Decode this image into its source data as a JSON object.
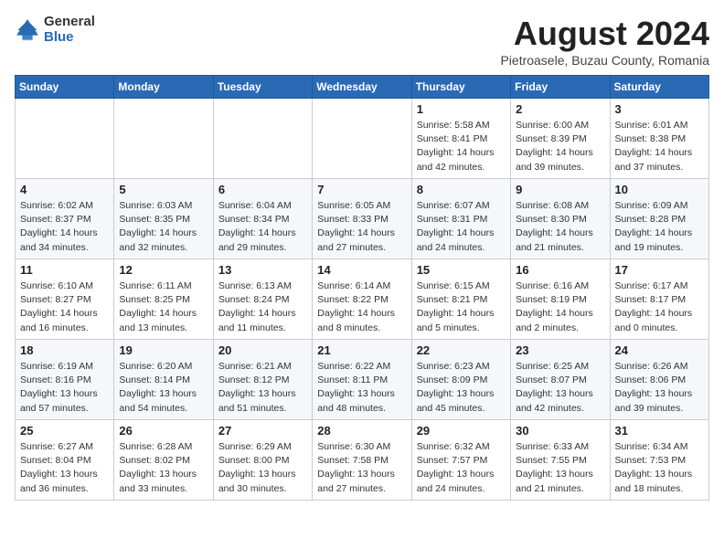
{
  "logo": {
    "general": "General",
    "blue": "Blue"
  },
  "header": {
    "title": "August 2024",
    "subtitle": "Pietroasele, Buzau County, Romania"
  },
  "weekdays": [
    "Sunday",
    "Monday",
    "Tuesday",
    "Wednesday",
    "Thursday",
    "Friday",
    "Saturday"
  ],
  "weeks": [
    [
      {
        "day": "",
        "info": ""
      },
      {
        "day": "",
        "info": ""
      },
      {
        "day": "",
        "info": ""
      },
      {
        "day": "",
        "info": ""
      },
      {
        "day": "1",
        "info": "Sunrise: 5:58 AM\nSunset: 8:41 PM\nDaylight: 14 hours and 42 minutes."
      },
      {
        "day": "2",
        "info": "Sunrise: 6:00 AM\nSunset: 8:39 PM\nDaylight: 14 hours and 39 minutes."
      },
      {
        "day": "3",
        "info": "Sunrise: 6:01 AM\nSunset: 8:38 PM\nDaylight: 14 hours and 37 minutes."
      }
    ],
    [
      {
        "day": "4",
        "info": "Sunrise: 6:02 AM\nSunset: 8:37 PM\nDaylight: 14 hours and 34 minutes."
      },
      {
        "day": "5",
        "info": "Sunrise: 6:03 AM\nSunset: 8:35 PM\nDaylight: 14 hours and 32 minutes."
      },
      {
        "day": "6",
        "info": "Sunrise: 6:04 AM\nSunset: 8:34 PM\nDaylight: 14 hours and 29 minutes."
      },
      {
        "day": "7",
        "info": "Sunrise: 6:05 AM\nSunset: 8:33 PM\nDaylight: 14 hours and 27 minutes."
      },
      {
        "day": "8",
        "info": "Sunrise: 6:07 AM\nSunset: 8:31 PM\nDaylight: 14 hours and 24 minutes."
      },
      {
        "day": "9",
        "info": "Sunrise: 6:08 AM\nSunset: 8:30 PM\nDaylight: 14 hours and 21 minutes."
      },
      {
        "day": "10",
        "info": "Sunrise: 6:09 AM\nSunset: 8:28 PM\nDaylight: 14 hours and 19 minutes."
      }
    ],
    [
      {
        "day": "11",
        "info": "Sunrise: 6:10 AM\nSunset: 8:27 PM\nDaylight: 14 hours and 16 minutes."
      },
      {
        "day": "12",
        "info": "Sunrise: 6:11 AM\nSunset: 8:25 PM\nDaylight: 14 hours and 13 minutes."
      },
      {
        "day": "13",
        "info": "Sunrise: 6:13 AM\nSunset: 8:24 PM\nDaylight: 14 hours and 11 minutes."
      },
      {
        "day": "14",
        "info": "Sunrise: 6:14 AM\nSunset: 8:22 PM\nDaylight: 14 hours and 8 minutes."
      },
      {
        "day": "15",
        "info": "Sunrise: 6:15 AM\nSunset: 8:21 PM\nDaylight: 14 hours and 5 minutes."
      },
      {
        "day": "16",
        "info": "Sunrise: 6:16 AM\nSunset: 8:19 PM\nDaylight: 14 hours and 2 minutes."
      },
      {
        "day": "17",
        "info": "Sunrise: 6:17 AM\nSunset: 8:17 PM\nDaylight: 14 hours and 0 minutes."
      }
    ],
    [
      {
        "day": "18",
        "info": "Sunrise: 6:19 AM\nSunset: 8:16 PM\nDaylight: 13 hours and 57 minutes."
      },
      {
        "day": "19",
        "info": "Sunrise: 6:20 AM\nSunset: 8:14 PM\nDaylight: 13 hours and 54 minutes."
      },
      {
        "day": "20",
        "info": "Sunrise: 6:21 AM\nSunset: 8:12 PM\nDaylight: 13 hours and 51 minutes."
      },
      {
        "day": "21",
        "info": "Sunrise: 6:22 AM\nSunset: 8:11 PM\nDaylight: 13 hours and 48 minutes."
      },
      {
        "day": "22",
        "info": "Sunrise: 6:23 AM\nSunset: 8:09 PM\nDaylight: 13 hours and 45 minutes."
      },
      {
        "day": "23",
        "info": "Sunrise: 6:25 AM\nSunset: 8:07 PM\nDaylight: 13 hours and 42 minutes."
      },
      {
        "day": "24",
        "info": "Sunrise: 6:26 AM\nSunset: 8:06 PM\nDaylight: 13 hours and 39 minutes."
      }
    ],
    [
      {
        "day": "25",
        "info": "Sunrise: 6:27 AM\nSunset: 8:04 PM\nDaylight: 13 hours and 36 minutes."
      },
      {
        "day": "26",
        "info": "Sunrise: 6:28 AM\nSunset: 8:02 PM\nDaylight: 13 hours and 33 minutes."
      },
      {
        "day": "27",
        "info": "Sunrise: 6:29 AM\nSunset: 8:00 PM\nDaylight: 13 hours and 30 minutes."
      },
      {
        "day": "28",
        "info": "Sunrise: 6:30 AM\nSunset: 7:58 PM\nDaylight: 13 hours and 27 minutes."
      },
      {
        "day": "29",
        "info": "Sunrise: 6:32 AM\nSunset: 7:57 PM\nDaylight: 13 hours and 24 minutes."
      },
      {
        "day": "30",
        "info": "Sunrise: 6:33 AM\nSunset: 7:55 PM\nDaylight: 13 hours and 21 minutes."
      },
      {
        "day": "31",
        "info": "Sunrise: 6:34 AM\nSunset: 7:53 PM\nDaylight: 13 hours and 18 minutes."
      }
    ]
  ]
}
